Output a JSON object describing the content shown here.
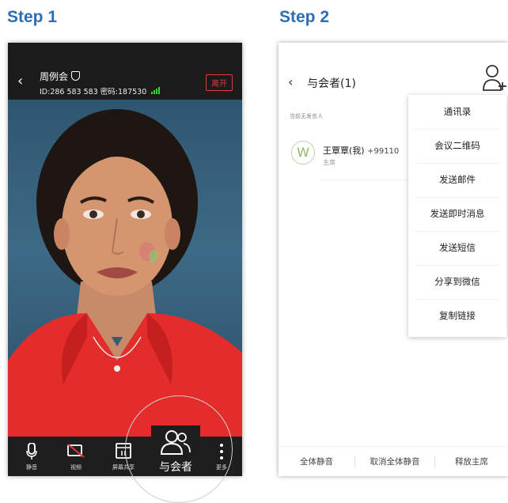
{
  "step1": {
    "title": "Step 1",
    "meeting_name": "周例会",
    "meeting_id": "ID:286 583 583 密码:187530",
    "leave_label": "离开",
    "toolbar": {
      "mute": "静音",
      "video": "视频",
      "share": "屏幕共享",
      "participants": "与会者",
      "more": "更多"
    }
  },
  "step2": {
    "title": "Step 2",
    "header_title": "与会者(1)",
    "no_speaker": "当前无发言人",
    "participant": {
      "avatar_letter": "W",
      "name": "王覃覃(我)",
      "phone": "+99110",
      "role": "主席"
    },
    "menu": [
      "通讯录",
      "会议二维码",
      "发送邮件",
      "发送即时消息",
      "发送短信",
      "分享到微信",
      "复制链接"
    ],
    "footer": {
      "mute_all": "全体静音",
      "unmute_all": "取消全体静音",
      "release_host": "释放主席"
    }
  },
  "colors": {
    "step_title": "#2e6db4",
    "leave": "#e03b3b",
    "signal": "#3fd13f",
    "avatar": "#8cbb6b"
  }
}
